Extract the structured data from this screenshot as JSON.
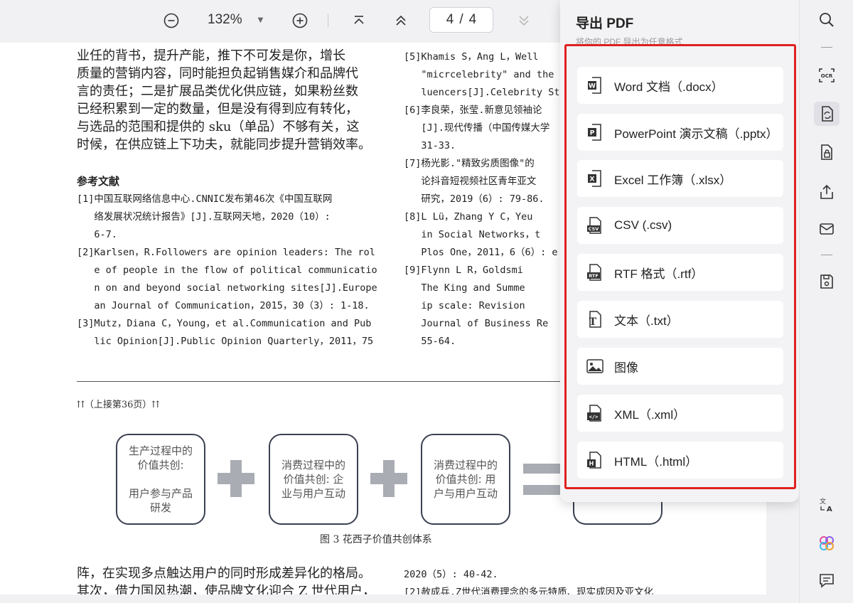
{
  "toolbar": {
    "zoom_value": "132%",
    "page_current": "4",
    "page_separator": "/",
    "page_total": "4"
  },
  "document": {
    "body_top": "业任的背书，提升产能，推下不可发是你，增长\n质量的营销内容，同时能担负起销售媒介和品牌代\n言的责任；二是扩展品类优化供应链，如果粉丝数\n已经积累到一定的数量，但是没有得到应有转化，\n与选品的范围和提供的 sku（单品）不够有关，这\n时候，在供应链上下功夫，就能同步提升营销效率。",
    "references_title": "参考文献",
    "refs_left": "[1]中国互联网络信息中心.CNNIC发布第46次《中国互联网\n   络发展状况统计报告》[J].互联网天地，2020（10）:\n   6-7.\n[2]Karlsen，R.Followers are opinion leaders: The rol\n   e of people in the flow of political communicatio\n   n on and beyond social networking sites[J].Europe\n   an Journal of Communication，2015，30（3）: 1-18.\n[3]Mutz，Diana C，Young，et al.Communication and Pub\n   lic Opinion[J].Public Opinion Quarterly，2011，75",
    "refs_right": "[5]Khamis S，Ang L，Well\n   \"micrcelebrity\" and the\n   luencers[J].Celebrity Stu\n[6]李良荣，张莹.新意见领袖论\n   [J].现代传播（中国传媒大学\n   31-33.\n[7]杨光影.\"精致劣质图像\"的\n   论抖音短视频社区青年亚文\n   研究，2019（6）: 79-86.\n[8]L Lü，Zhang Y C，Yeu\n   in Social Networks，t\n   Plos One，2011，6（6）: e\n[9]Flynn L R，Goldsmi\n   The King and Summe\n   ip scale: Revision\n   Journal of Business Re\n   55-64.",
    "continued": "⇈（上接第36页）⇈",
    "box1": "生产过程中的\n价值共创:\n\n用户参与产品\n研发",
    "box2": "消费过程中的\n价值共创: 企\n业与用户互动",
    "box3": "消费过程中的\n价值共创: 用\n户与用户互动",
    "figure_caption": "图 3   花西子价值共创体系",
    "body_bottom": "阵，在实现多点触达用户的同时形成差异化的格局。\n其次，借力国风热潮，使品牌文化迎合 Z 世代用户，",
    "refs_bottom": "2020（5）: 40-42.\n[2]赦成兵.Z世代消费理念的多元特质、现实成因及亚文化"
  },
  "export_panel": {
    "title": "导出 PDF",
    "subtitle": "将你的 PDF 导出为任意格式",
    "options": [
      {
        "label": "Word 文档（.docx）",
        "icon": "word-icon",
        "color": "#2b2b2b"
      },
      {
        "label": "PowerPoint 演示文稿（.pptx）",
        "icon": "powerpoint-icon",
        "color": "#2b2b2b"
      },
      {
        "label": "Excel 工作簿（.xlsx）",
        "icon": "excel-icon",
        "color": "#2b2b2b"
      },
      {
        "label": "CSV (.csv)",
        "icon": "csv-icon",
        "color": "#2b2b2b"
      },
      {
        "label": "RTF 格式（.rtf）",
        "icon": "rtf-icon",
        "color": "#2b2b2b"
      },
      {
        "label": "文本（.txt）",
        "icon": "text-icon",
        "color": "#2b2b2b"
      },
      {
        "label": "图像",
        "icon": "image-icon",
        "color": "#2b2b2b"
      },
      {
        "label": "XML（.xml）",
        "icon": "xml-icon",
        "color": "#2b2b2b"
      },
      {
        "label": "HTML（.html）",
        "icon": "html-icon",
        "color": "#2b2b2b"
      }
    ],
    "highlight_color": "#e02020"
  },
  "rail": {
    "icons": [
      "search-icon",
      "ocr-icon",
      "convert-icon",
      "protect-icon",
      "share-icon",
      "mail-icon",
      "save-icon",
      "translate-icon",
      "ai-assistant-icon",
      "comment-icon"
    ]
  }
}
